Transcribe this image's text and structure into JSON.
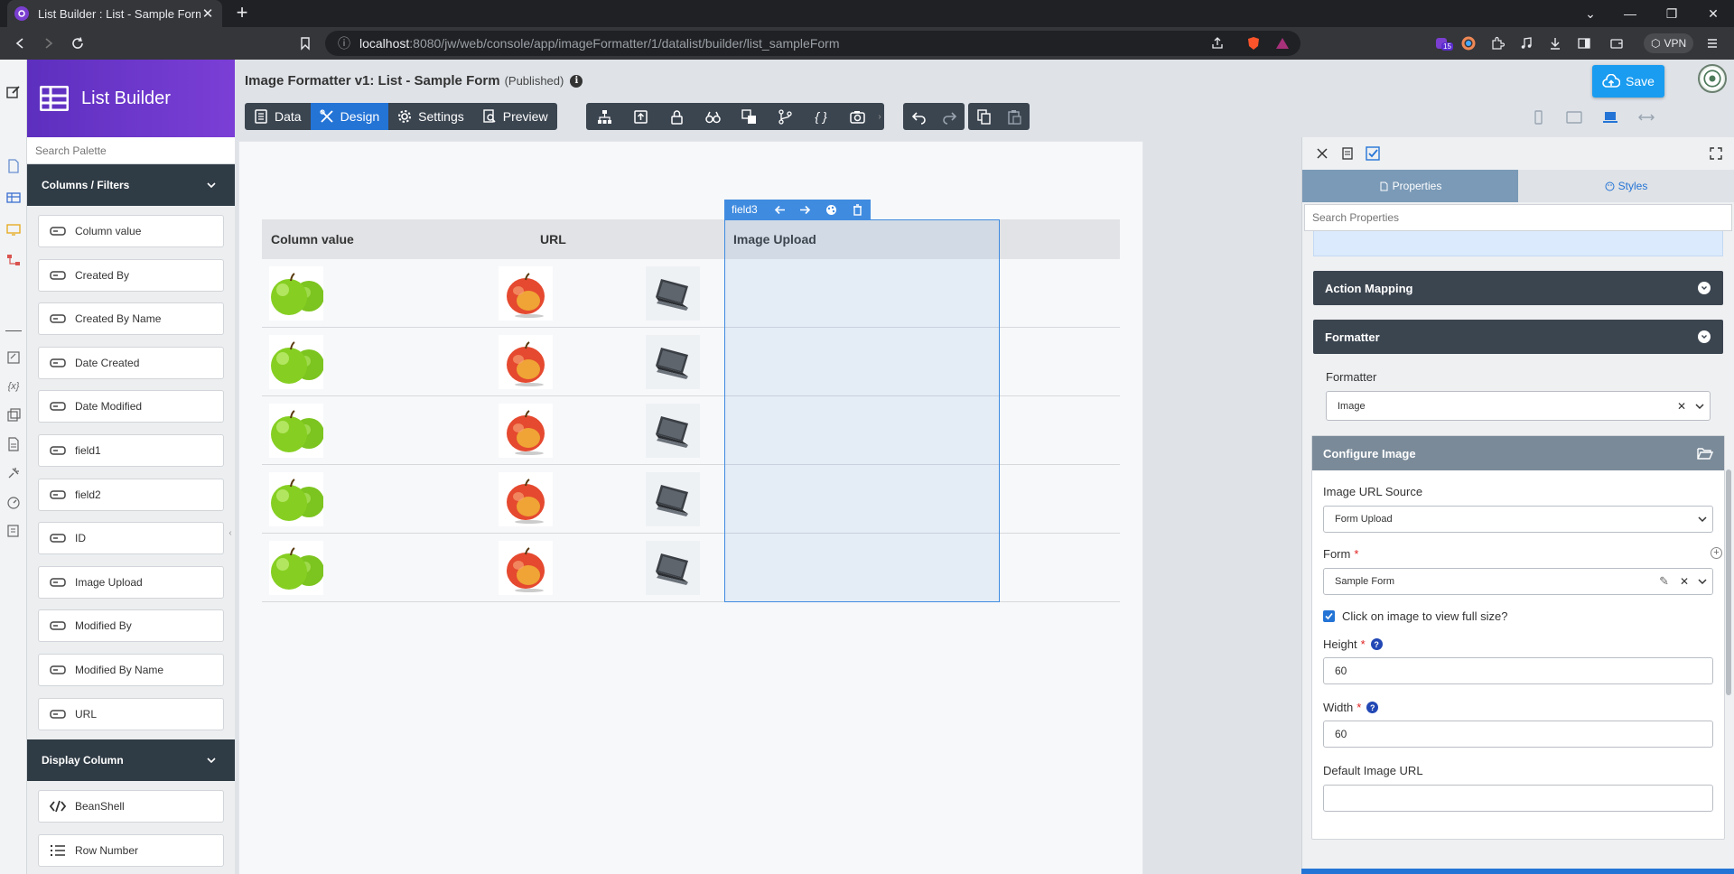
{
  "browser": {
    "tab_title": "List Builder : List - Sample Form",
    "url_host": "localhost",
    "url_path": ":8080/jw/web/console/app/imageFormatter/1/datalist/builder/list_sampleForm",
    "ext_badge": "15",
    "vpn_label": "VPN"
  },
  "palette": {
    "brand": "List Builder",
    "search_placeholder": "Search Palette",
    "section_columns": "Columns / Filters",
    "columns": [
      "Column value",
      "Created By",
      "Created By Name",
      "Date Created",
      "Date Modified",
      "field1",
      "field2",
      "ID",
      "Image Upload",
      "Modified By",
      "Modified By Name",
      "URL"
    ],
    "section_display": "Display Column",
    "display_columns": [
      "BeanShell",
      "Row Number"
    ]
  },
  "header": {
    "title": "Image Formatter v1: List - Sample Form",
    "status": "(Published)",
    "tabs": {
      "data": "Data",
      "design": "Design",
      "settings": "Settings",
      "preview": "Preview"
    },
    "save_label": "Save"
  },
  "canvas": {
    "selected_field": "field3",
    "columns": [
      "Column value",
      "URL",
      "Image Upload"
    ],
    "row_count": 5,
    "cells": [
      "green-apple-image",
      "red-apple-image",
      "laptop-image"
    ]
  },
  "properties": {
    "tab_properties": "Properties",
    "tab_styles": "Styles",
    "search_placeholder": "Search Properties",
    "section_action_mapping": "Action Mapping",
    "section_formatter": "Formatter",
    "formatter_label": "Formatter",
    "formatter_value": "Image",
    "configure_title": "Configure Image",
    "url_source_label": "Image URL Source",
    "url_source_value": "Form Upload",
    "form_label": "Form",
    "form_value": "Sample Form",
    "click_full_size_label": "Click on image to view full size?",
    "click_full_size_checked": true,
    "height_label": "Height",
    "height_value": "60",
    "width_label": "Width",
    "width_value": "60",
    "default_image_label": "Default Image URL",
    "default_image_value": ""
  },
  "colors": {
    "brand": "#6a35cc",
    "accent": "#2474d6",
    "dark": "#3b4550"
  }
}
